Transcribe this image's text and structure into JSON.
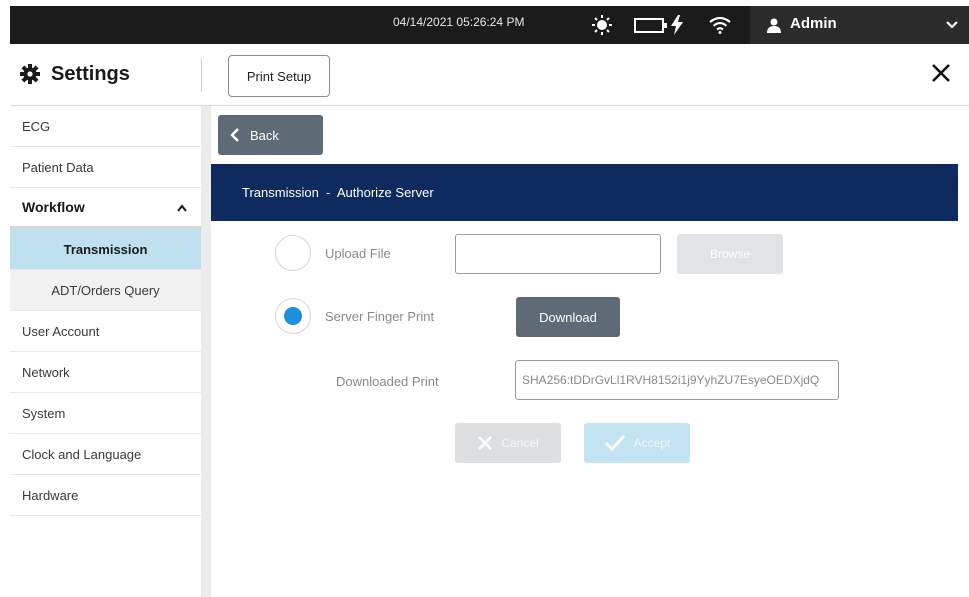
{
  "status_bar": {
    "datetime": "04/14/2021 05:26:24 PM",
    "brightness_icon": "sun-icon",
    "battery_icon": "battery-charging-icon",
    "wifi_icon": "wifi-icon",
    "user": {
      "name": "Admin",
      "icon": "user-icon",
      "menu_icon": "chevron-down-icon"
    }
  },
  "header": {
    "title": "Settings",
    "icon": "gear-icon",
    "print_setup_label": "Print Setup",
    "close_icon": "close-icon"
  },
  "sidebar": {
    "items": [
      {
        "label": "ECG"
      },
      {
        "label": "Patient Data"
      },
      {
        "label": "Workflow",
        "expanded": true
      },
      {
        "label": "Transmission",
        "active": true
      },
      {
        "label": "ADT/Orders Query"
      },
      {
        "label": "User Account"
      },
      {
        "label": "Network"
      },
      {
        "label": "System"
      },
      {
        "label": "Clock and Language"
      },
      {
        "label": "Hardware"
      }
    ]
  },
  "content": {
    "back_label": "Back",
    "banner": "Transmission  -  Authorize Server",
    "upload": {
      "label": "Upload File",
      "value": "",
      "selected": false,
      "browse_label": "Browse",
      "browse_enabled": false
    },
    "server": {
      "label": "Server Finger Print",
      "selected": true,
      "download_label": "Download"
    },
    "downloaded_print": {
      "label": "Downloaded Print",
      "value": "SHA256:tDDrGvLl1RVH8152i1j9YyhZU7EsyeOEDXjdQ"
    },
    "actions": {
      "cancel_label": "Cancel",
      "accept_label": "Accept",
      "enabled": false
    }
  },
  "colors": {
    "banner": "#0e2a5e",
    "primary_button": "#5e6a76",
    "radio_selected": "#1d8fdb",
    "active_nav": "#bfe0ef"
  }
}
